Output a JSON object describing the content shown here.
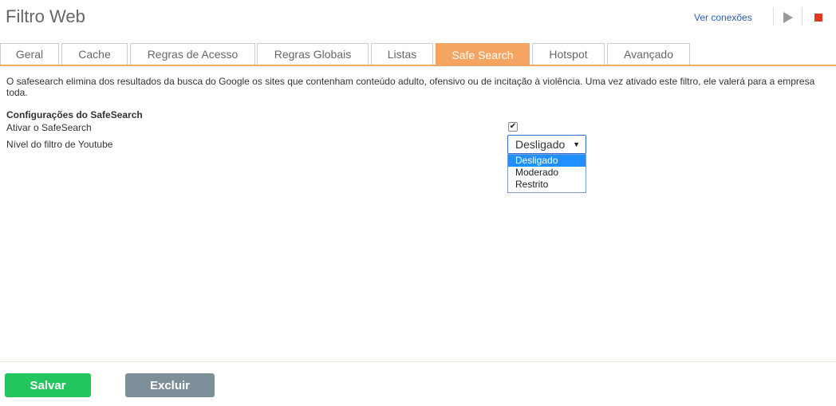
{
  "header": {
    "title": "Filtro Web",
    "connections_link": "Ver conexões",
    "icons": [
      "play-icon",
      "stop-icon"
    ],
    "stop_color": "#e13a1a"
  },
  "tabs": [
    {
      "label": "Geral",
      "active": false
    },
    {
      "label": "Cache",
      "active": false
    },
    {
      "label": "Regras de Acesso",
      "active": false
    },
    {
      "label": "Regras Globais",
      "active": false
    },
    {
      "label": "Listas",
      "active": false
    },
    {
      "label": "Safe Search",
      "active": true
    },
    {
      "label": "Hotspot",
      "active": false
    },
    {
      "label": "Avançado",
      "active": false
    }
  ],
  "accent_color": "#f5a462",
  "content": {
    "description": "O safesearch elimina dos resultados da busca do Google os sites que contenham conteúdo adulto, ofensivo ou de incitação à violência. Uma vez ativado este filtro, ele valerá para a empresa toda.",
    "section_title": "Configurações do SafeSearch",
    "enable_label": "Ativar o SafeSearch",
    "enable_checked": true,
    "youtube_label": "Nível do filtro de Youtube",
    "youtube_select": {
      "value": "Desligado",
      "options": [
        "Desligado",
        "Moderado",
        "Restrito"
      ],
      "highlighted": "Desligado"
    }
  },
  "footer": {
    "save_label": "Salvar",
    "delete_label": "Excluir",
    "save_color": "#22c55e",
    "delete_color": "#7d8f99"
  }
}
